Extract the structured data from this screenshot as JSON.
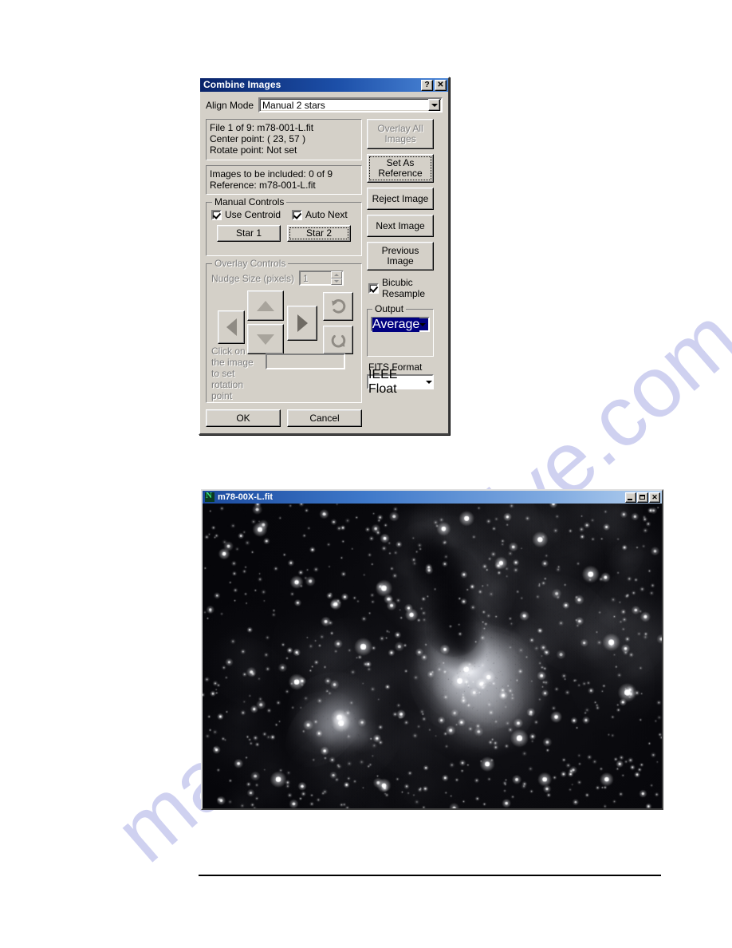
{
  "dialog": {
    "title": "Combine Images",
    "titlebar_buttons": [
      {
        "name": "help-button",
        "label": "?"
      },
      {
        "name": "close-button",
        "label": "✕"
      }
    ],
    "align_mode": {
      "label": "Align Mode",
      "value": "Manual 2 stars"
    },
    "file_info": {
      "line1": "File 1 of 9:  m78-001-L.fit",
      "line2": "Center point: ( 23, 57 )",
      "line3": "Rotate point: Not set"
    },
    "include_info": {
      "line1": "Images to be included: 0 of 9",
      "line2": "Reference: m78-001-L.fit"
    },
    "manual_controls": {
      "title": "Manual Controls",
      "use_centroid": {
        "label": "Use Centroid",
        "checked": true
      },
      "auto_next": {
        "label": "Auto Next",
        "checked": true
      },
      "star1": "Star 1",
      "star2": "Star 2"
    },
    "overlay_controls": {
      "title": "Overlay Controls",
      "enabled": false,
      "nudge_label": "Nudge Size (pixels)",
      "nudge_value": "1",
      "rotation_note": "Click on the image to set rotation point",
      "rotation_value": "",
      "arrows": [
        "nudge-up",
        "nudge-down",
        "nudge-left",
        "nudge-right",
        "rotate-ccw",
        "rotate-cw"
      ]
    },
    "side_buttons": [
      {
        "name": "overlay-all-images-button",
        "label": "Overlay All Images",
        "enabled": false,
        "focused": false
      },
      {
        "name": "set-as-reference-button",
        "label": "Set As Reference",
        "enabled": true,
        "focused": true
      },
      {
        "name": "reject-image-button",
        "label": "Reject Image",
        "enabled": true,
        "focused": false
      },
      {
        "name": "next-image-button",
        "label": "Next Image",
        "enabled": true,
        "focused": false
      },
      {
        "name": "previous-image-button",
        "label": "Previous Image",
        "enabled": true,
        "focused": false
      }
    ],
    "bicubic": {
      "label": "Bicubic Resample",
      "checked": true
    },
    "output": {
      "title": "Output",
      "value": "Average"
    },
    "fits_format": {
      "label": "FITS Format",
      "value": "IEEE Float"
    },
    "ok_label": "OK",
    "cancel_label": "Cancel"
  },
  "image_window": {
    "title": "m78-00X-L.fit",
    "icon": "fits-document-icon",
    "buttons": [
      {
        "name": "minimize-button",
        "label": "_"
      },
      {
        "name": "maximize-button",
        "label": "□"
      },
      {
        "name": "close-button",
        "label": "✕"
      }
    ]
  },
  "watermark": {
    "text": "manualsarchive.com"
  },
  "colors": {
    "dialog_face": "#d4d0c8",
    "titlebar_start": "#0a246a",
    "titlebar_end": "#4c87d8",
    "selection_blue": "#000080",
    "watermark": "#b3b6e8"
  }
}
